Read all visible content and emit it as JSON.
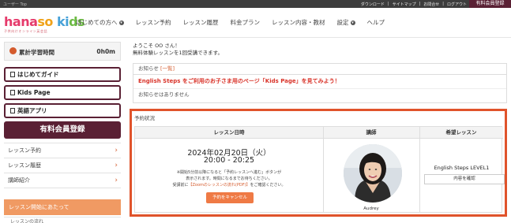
{
  "topbar": {
    "tag": "ユーザー Top",
    "links": [
      "ダウンロード",
      "サイトマップ",
      "お問合せ",
      "ログアウト"
    ],
    "register": "有料会員登録"
  },
  "header": {
    "logo_parts": [
      "hana",
      "so ",
      "ki",
      "ds"
    ],
    "logo_sub": "子供向けオンライン英会話",
    "nav": [
      {
        "label": "はじめての方へ",
        "dropdown": true
      },
      {
        "label": "レッスン予約",
        "dropdown": false
      },
      {
        "label": "レッスン履歴",
        "dropdown": false
      },
      {
        "label": "料金プラン",
        "dropdown": false
      },
      {
        "label": "レッスン内容・教材",
        "dropdown": false
      },
      {
        "label": "設定",
        "dropdown": true
      },
      {
        "label": "ヘルプ",
        "dropdown": false
      }
    ]
  },
  "sidebar": {
    "study_label": "累計学習時間",
    "study_value": "0h0m",
    "buttons": [
      "はじめてガイド",
      "Kids Page",
      "英語アプリ"
    ],
    "paid_register": "有料会員登録",
    "menu": [
      "レッスン予約",
      "レッスン履歴",
      "講師紹介"
    ],
    "section": "レッスン開始にあたって",
    "section_item": "レッスンの流れ"
  },
  "main": {
    "greeting": "ようこそ OO さん！",
    "greeting_sub": "無料体験レッスンを1回受講できます。",
    "news_title": "お知らせ",
    "news_link": "[一覧]",
    "news_alert": "English Steps をご利用のお子さま用のページ「Kids Page」を見てみよう！",
    "news_empty": "お知らせはありません",
    "booking": {
      "title": "予約状況",
      "headers": [
        "レッスン日時",
        "講師",
        "希望レッスン"
      ],
      "date": "2024年02月20日（火）",
      "time": "20:00 - 20:25",
      "note_1": "※開始5分前以降になると「予約レッスンへ進む」ボタンが",
      "note_2": "表示されます。時間になるまでお待ちください。",
      "note_3a": "受講前に",
      "note_3b": "【Zoomのレッスンの流れ(PDF)】",
      "note_3c": "をご確認ください。",
      "cancel": "予約をキャンセル",
      "teacher": "Audrey",
      "lesson": "English Steps LEVEL1",
      "confirm": "内容を確認"
    }
  }
}
